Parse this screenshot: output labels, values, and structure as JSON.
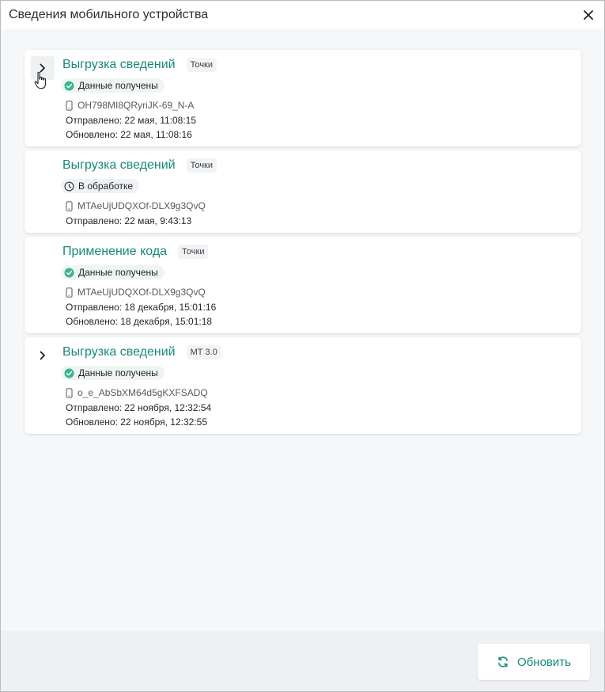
{
  "dialog": {
    "title": "Сведения мобильного устройства",
    "close_icon": "close-icon"
  },
  "cards": [
    {
      "title": "Выгрузка сведений",
      "tag": "Точки",
      "status": "Данные получены",
      "status_icon": "check-circle-icon",
      "device": "OH798MI8QRyriJK-69_N-A",
      "sent": "Отправлено: 22 мая, 11:08:15",
      "updated": "Обновлено: 22 мая, 11:08:16"
    },
    {
      "title": "Выгрузка сведений",
      "tag": "Точки",
      "status": "В обработке",
      "status_icon": "clock-icon",
      "device": "MTAeUjUDQXOf-DLX9g3QvQ",
      "sent": "Отправлено: 22 мая, 9:43:13"
    },
    {
      "title": "Применение кода",
      "tag": "Точки",
      "status": "Данные получены",
      "status_icon": "check-circle-icon",
      "device": "MTAeUjUDQXOf-DLX9g3QvQ",
      "sent": "Отправлено: 18 декабря, 15:01:16",
      "updated": "Обновлено: 18 декабря, 15:01:18"
    },
    {
      "title": "Выгрузка сведений",
      "tag": "МТ 3.0",
      "status": "Данные получены",
      "status_icon": "check-circle-icon",
      "device": "o_e_AbSbXM64d5gKXFSADQ",
      "sent": "Отправлено: 22 ноября, 12:32:54",
      "updated": "Обновлено: 22 ноября, 12:32:55"
    }
  ],
  "footer": {
    "refresh_label": "Обновить",
    "refresh_icon": "refresh-icon"
  },
  "colors": {
    "accent": "#16897a",
    "success": "#3bb58a",
    "background": "#f6f7f9"
  }
}
